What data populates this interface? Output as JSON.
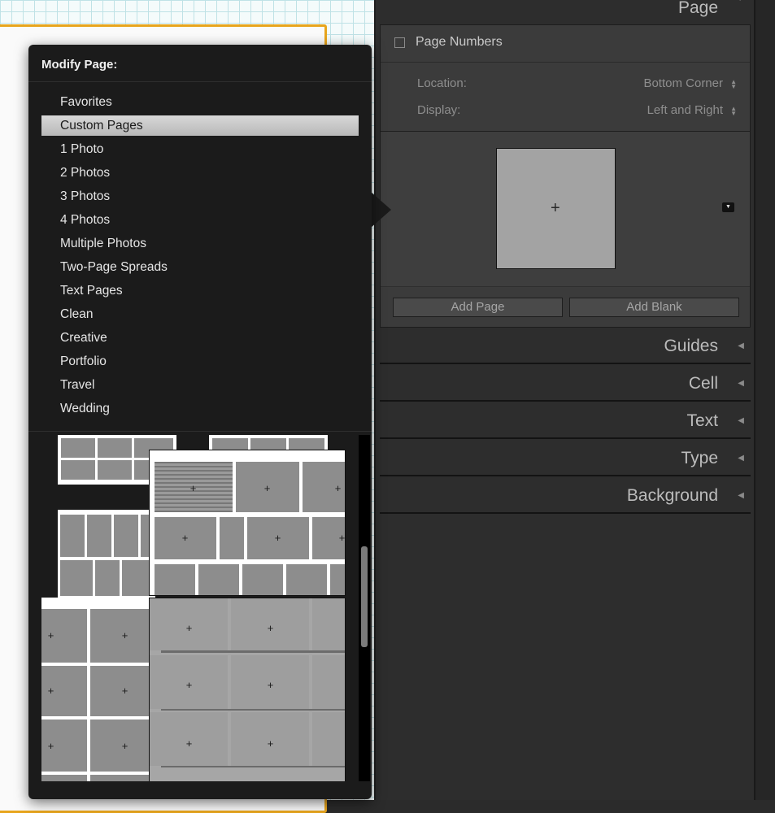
{
  "popup": {
    "title": "Modify Page:",
    "menu": [
      "Favorites",
      "Custom Pages",
      "1 Photo",
      "2 Photos",
      "3 Photos",
      "4 Photos",
      "Multiple Photos",
      "Two-Page Spreads",
      "Text Pages",
      "Clean",
      "Creative",
      "Portfolio",
      "Travel",
      "Wedding"
    ],
    "selected_index": 1
  },
  "panel": {
    "page_header": "Page",
    "page_numbers_label": "Page Numbers",
    "page_numbers_checked": false,
    "location_label": "Location:",
    "location_value": "Bottom Corner",
    "display_label": "Display:",
    "display_value": "Left and Right",
    "add_page_label": "Add Page",
    "add_blank_label": "Add Blank",
    "sections": [
      "Guides",
      "Cell",
      "Text",
      "Type",
      "Background"
    ]
  },
  "icons": {
    "collapse": "triangle-down-icon",
    "expand": "triangle-left-icon",
    "add_photo": "plus-icon"
  },
  "colors": {
    "accent_frame": "#e8a51d",
    "menu_selected": "#c8c8c8"
  }
}
